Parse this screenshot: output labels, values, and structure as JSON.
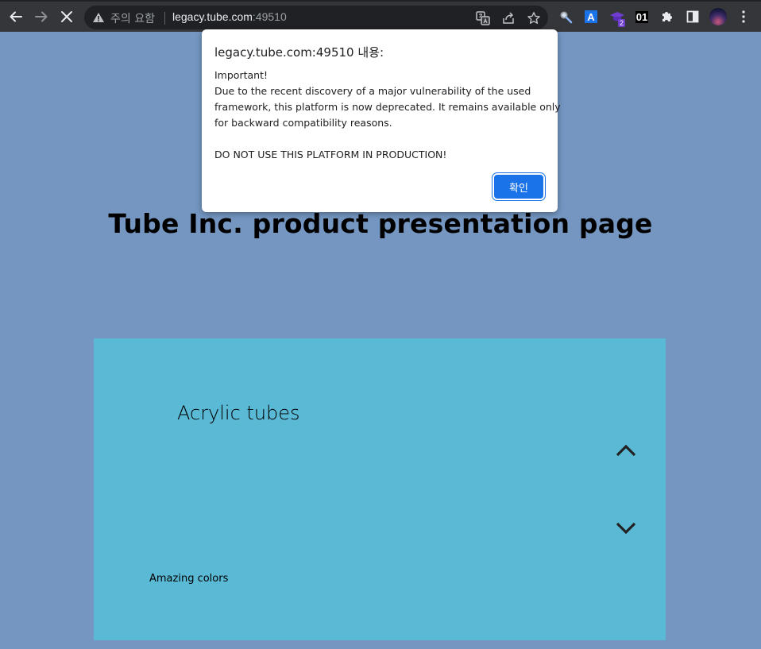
{
  "browser": {
    "security_label": "주의 요함",
    "url_host": "legacy.tube.com",
    "url_port": ":49510",
    "extension_badge": "2",
    "extension_text": "01"
  },
  "page": {
    "title": "Tube Inc. product presentation page",
    "product": {
      "name": "Acrylic tubes",
      "description": "Amazing colors"
    }
  },
  "dialog": {
    "title": "legacy.tube.com:49510 내용:",
    "lines": [
      "Important!",
      "Due to the recent discovery of a major vulnerability of the used",
      "framework, this platform is now deprecated. It remains available only",
      "for backward compatibility reasons.",
      "",
      "DO NOT USE THIS PLATFORM IN PRODUCTION!"
    ],
    "ok_label": "확인"
  },
  "colors": {
    "page_bg": "#7496c1",
    "card_bg": "#5ab9d5",
    "button_blue": "#1a73e8",
    "chrome_dark": "#35363a"
  }
}
